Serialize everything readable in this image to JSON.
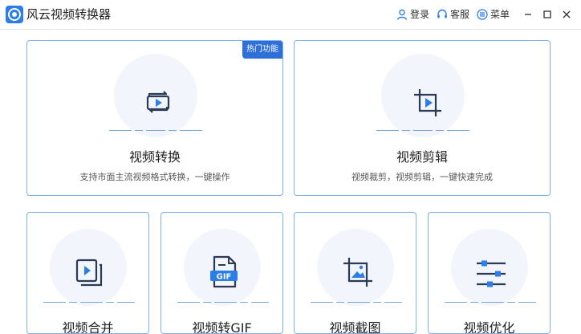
{
  "window": {
    "title": "风云视频转换器",
    "login_label": "登录",
    "service_label": "客服",
    "menu_label": "菜单"
  },
  "colors": {
    "accent": "#2b7de9",
    "card_border": "#7fb0ea",
    "badge": "#2e6fd8"
  },
  "cards": {
    "video_convert": {
      "badge": "热门功能",
      "title": "视频转换",
      "desc": "支持市面主流视频格式转换，一键操作",
      "icon": "video-convert-icon"
    },
    "video_crop": {
      "title": "视频剪辑",
      "desc": "视频裁剪，视频剪辑，一键快速完成",
      "icon": "video-crop-icon"
    },
    "video_merge": {
      "title": "视频合并",
      "icon": "video-merge-icon"
    },
    "video_gif": {
      "title": "视频转GIF",
      "icon": "gif-file-icon"
    },
    "video_screenshot": {
      "title": "视频截图",
      "icon": "image-crop-icon"
    },
    "video_optimize": {
      "title": "视频优化",
      "icon": "sliders-icon"
    }
  }
}
